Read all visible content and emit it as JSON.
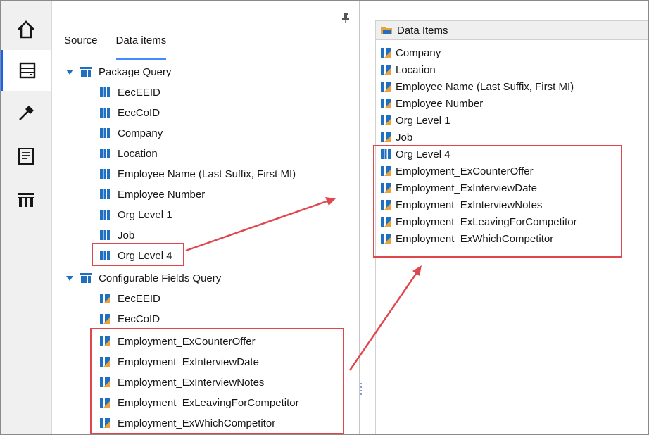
{
  "rail": {
    "items": [
      {
        "icon": "home-icon"
      },
      {
        "icon": "data-sources-icon"
      },
      {
        "icon": "hammer-icon"
      },
      {
        "icon": "report-icon"
      },
      {
        "icon": "table-icon"
      }
    ]
  },
  "left": {
    "tabs": [
      {
        "label": "Source"
      },
      {
        "label": "Data items"
      }
    ],
    "package_query": {
      "label": "Package Query",
      "items": [
        "EecEEID",
        "EecCoID",
        "Company",
        "Location",
        "Employee Name (Last Suffix, First MI)",
        "Employee Number",
        "Org Level 1",
        "Job",
        "Org Level 4"
      ]
    },
    "config_query": {
      "label": "Configurable Fields Query",
      "items": [
        "EecEEID",
        "EecCoID",
        "Employment_ExCounterOffer",
        "Employment_ExInterviewDate",
        "Employment_ExInterviewNotes",
        "Employment_ExLeavingForCompetitor",
        "Employment_ExWhichCompetitor"
      ]
    }
  },
  "right": {
    "header": "Data Items",
    "items": [
      "Company",
      "Location",
      "Employee Name (Last Suffix, First MI)",
      "Employee Number",
      "Org Level 1",
      "Job",
      "Org Level 4",
      "Employment_ExCounterOffer",
      "Employment_ExInterviewDate",
      "Employment_ExInterviewNotes",
      "Employment_ExLeavingForCompetitor",
      "Employment_ExWhichCompetitor"
    ]
  },
  "colors": {
    "accent": "#0f62fe",
    "highlight": "#e0474c",
    "query_icon": "#1f70c1",
    "calc_icon": "#e8a33d"
  }
}
